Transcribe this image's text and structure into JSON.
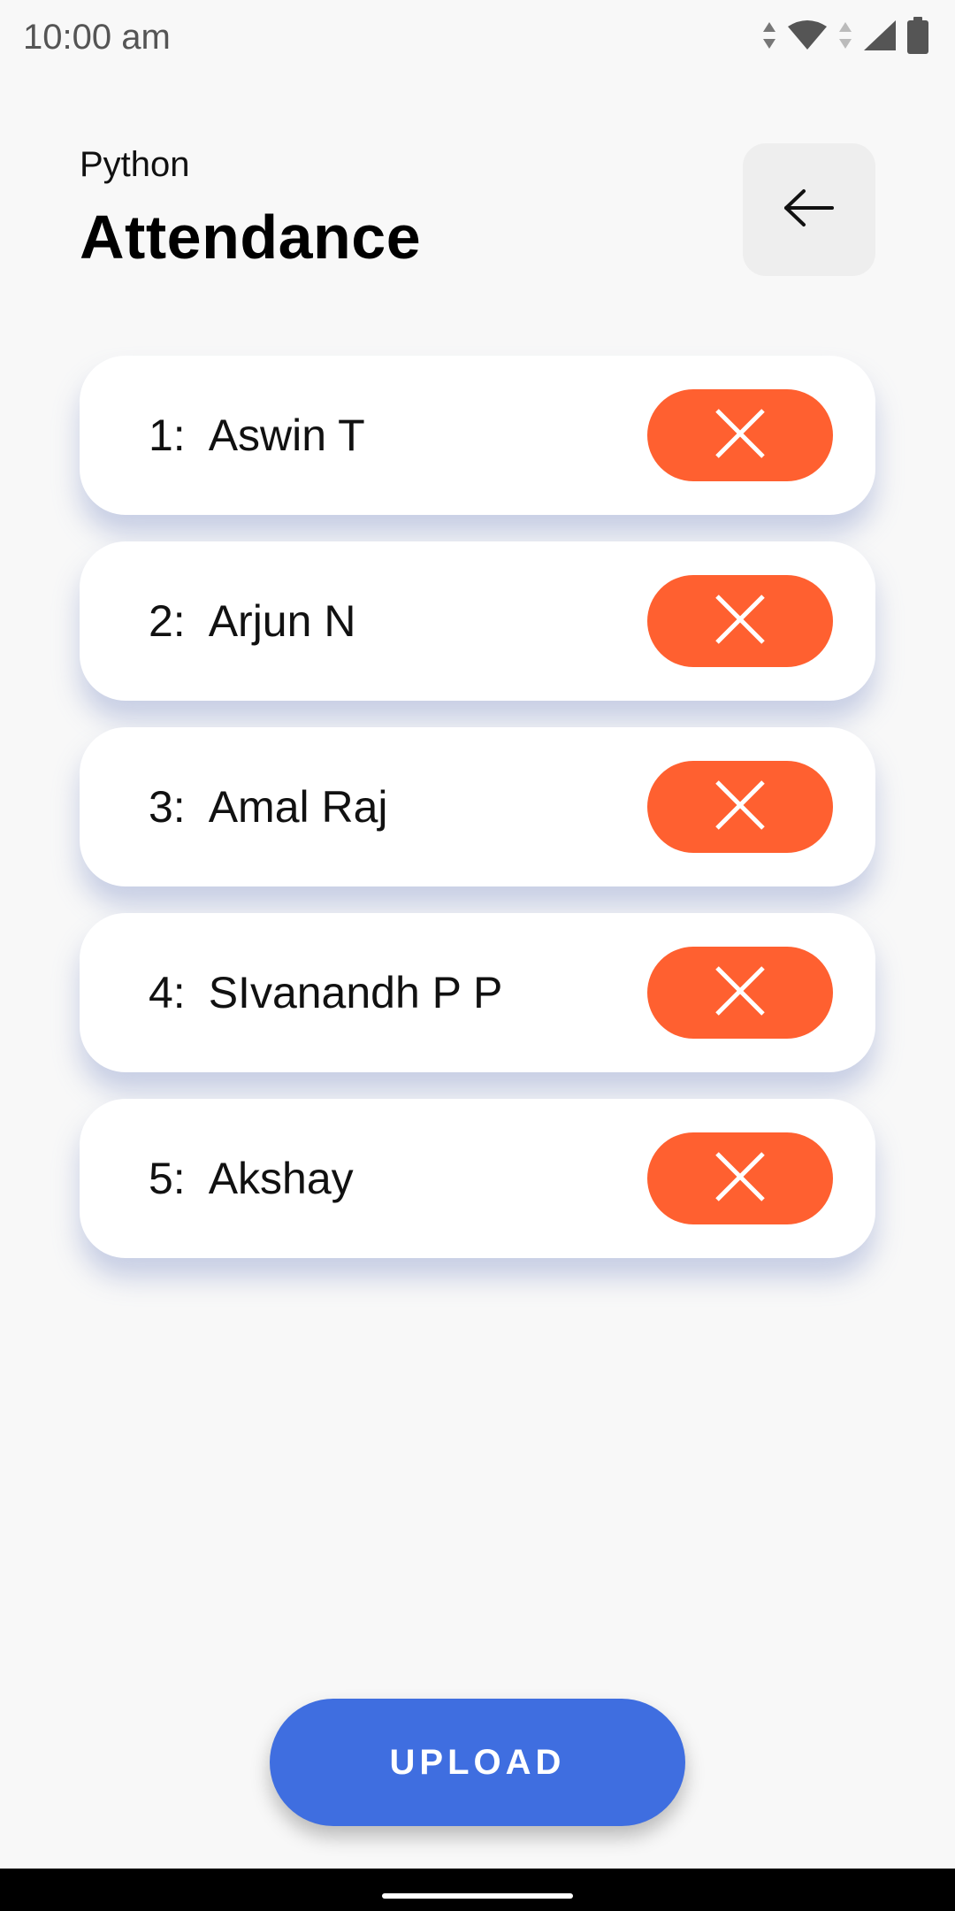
{
  "status_bar": {
    "time": "10:00 am"
  },
  "header": {
    "subtitle": "Python",
    "title": "Attendance"
  },
  "students": [
    {
      "number": "1:",
      "name": "Aswin T"
    },
    {
      "number": "2:",
      "name": "Arjun N"
    },
    {
      "number": "3:",
      "name": "Amal Raj"
    },
    {
      "number": "4:",
      "name": "SIvanandh P P"
    },
    {
      "number": "5:",
      "name": "Akshay"
    }
  ],
  "footer": {
    "upload_label": "UPLOAD"
  },
  "colors": {
    "background": "#f8f8f8",
    "absent_button": "#ff6030",
    "upload_button": "#3f6ee0",
    "back_button_bg": "#eeeeee"
  },
  "icons": {
    "back": "arrow-left-icon",
    "absent": "close-icon",
    "wifi": "wifi-icon",
    "signal": "signal-icon",
    "battery": "battery-icon"
  }
}
